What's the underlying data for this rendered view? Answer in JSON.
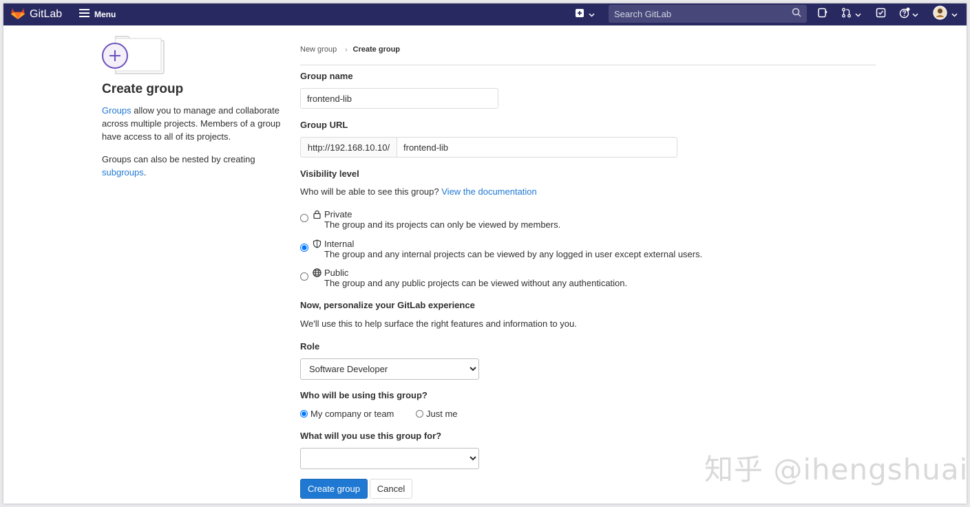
{
  "navbar": {
    "brand": "GitLab",
    "menu_label": "Menu",
    "search_placeholder": "Search GitLab",
    "colors": {
      "background": "#292961",
      "search": "#47477a"
    }
  },
  "sidebar": {
    "title": "Create group",
    "intro_link": "Groups",
    "intro_text": " allow you to manage and collaborate across multiple projects. Members of a group have access to all of its projects.",
    "nested_text": "Groups can also be nested by creating ",
    "nested_link": "subgroups",
    "nested_end": "."
  },
  "breadcrumb": {
    "parent": "New group",
    "current": "Create group"
  },
  "form": {
    "group_name_label": "Group name",
    "group_name_value": "frontend-lib",
    "group_url_label": "Group URL",
    "group_url_prefix": "http://192.168.10.10/",
    "group_url_value": "frontend-lib",
    "visibility_label": "Visibility level",
    "visibility_question": "Who will be able to see this group?",
    "visibility_doc_link": "View the documentation",
    "visibility_options": [
      {
        "title": "Private",
        "desc": "The group and its projects can only be viewed by members.",
        "icon": "lock-icon",
        "selected": false
      },
      {
        "title": "Internal",
        "desc": "The group and any internal projects can be viewed by any logged in user except external users.",
        "icon": "shield-icon",
        "selected": true
      },
      {
        "title": "Public",
        "desc": "The group and any public projects can be viewed without any authentication.",
        "icon": "globe-icon",
        "selected": false
      }
    ],
    "personalize_heading": "Now, personalize your GitLab experience",
    "personalize_text": "We'll use this to help surface the right features and information to you.",
    "role_label": "Role",
    "role_value": "Software Developer",
    "using_label": "Who will be using this group?",
    "using_options": [
      {
        "label": "My company or team",
        "selected": true
      },
      {
        "label": "Just me",
        "selected": false
      }
    ],
    "purpose_label": "What will you use this group for?",
    "purpose_value": "",
    "create_button": "Create group",
    "cancel_button": "Cancel"
  },
  "watermark": "知乎 @ihengshuai"
}
